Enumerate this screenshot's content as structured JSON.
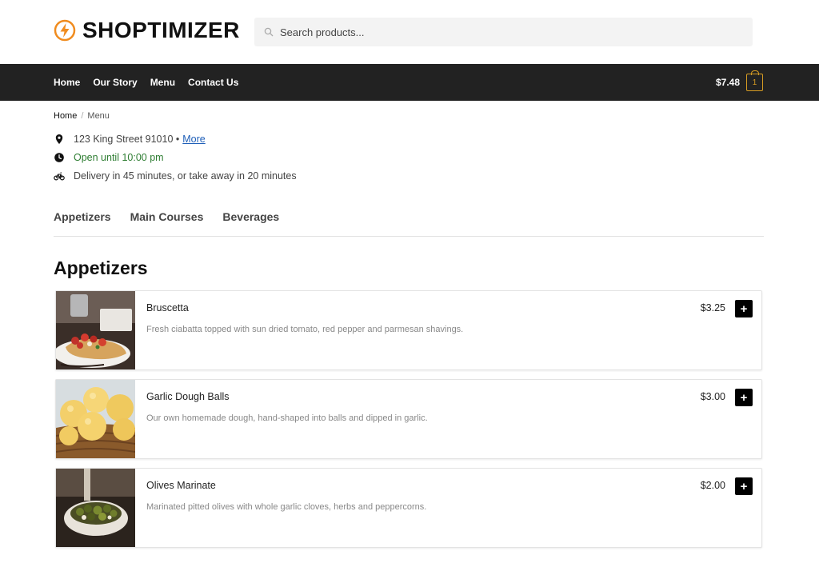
{
  "header": {
    "logo_text": "SHOPTIMIZER",
    "search_placeholder": "Search products..."
  },
  "nav": {
    "items": [
      "Home",
      "Our Story",
      "Menu",
      "Contact Us"
    ],
    "cart_total": "$7.48",
    "cart_count": "1"
  },
  "breadcrumb": {
    "home": "Home",
    "separator": "/",
    "current": "Menu"
  },
  "info": {
    "address": "123 King Street 91010 •",
    "more_link": "More",
    "open_status": "Open until 10:00 pm",
    "delivery": "Delivery in 45 minutes, or take away in 20 minutes"
  },
  "tabs": [
    "Appetizers",
    "Main Courses",
    "Beverages"
  ],
  "section": {
    "title": "Appetizers",
    "items": [
      {
        "name": "Bruscetta",
        "price": "$3.25",
        "description": "Fresh ciabatta topped with sun dried tomato, red pepper and parmesan shavings.",
        "add": "+"
      },
      {
        "name": "Garlic Dough Balls",
        "price": "$3.00",
        "description": "Our own homemade dough, hand-shaped into balls and dipped in garlic.",
        "add": "+"
      },
      {
        "name": "Olives Marinate",
        "price": "$2.00",
        "description": "Marinated pitted olives with whole garlic cloves, herbs and peppercorns.",
        "add": "+"
      }
    ]
  },
  "colors": {
    "nav_bg": "#222222",
    "accent": "#d59b23",
    "logo_orange": "#f08c1f",
    "open_green": "#2e7d32",
    "link_blue": "#1f5fb8"
  }
}
